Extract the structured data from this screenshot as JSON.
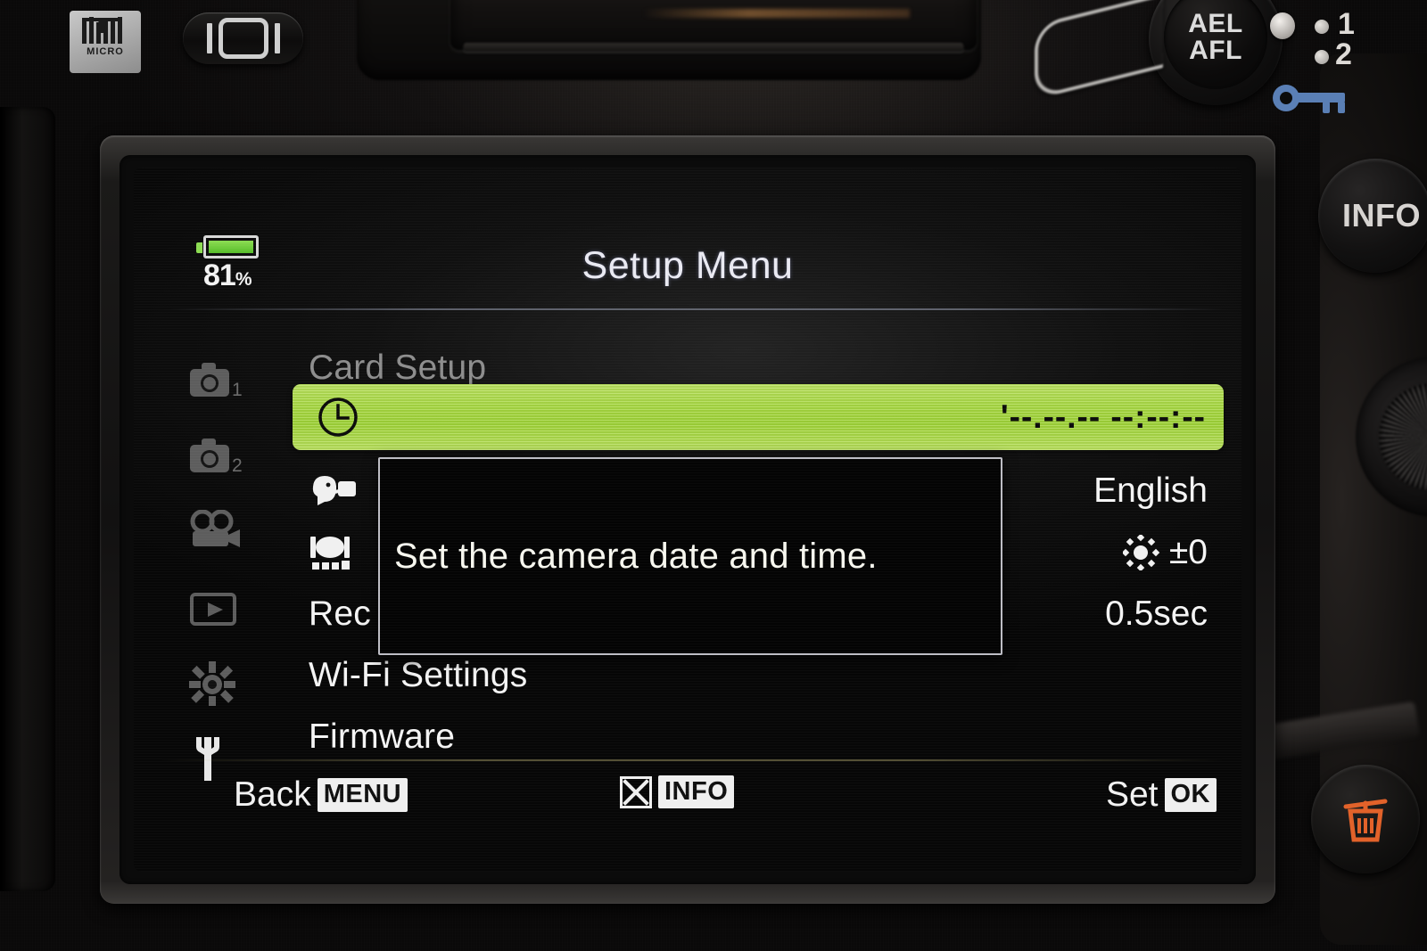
{
  "camera": {
    "logo_text": "MICRO",
    "lv_button": "live-view-button",
    "ael_afl_label_top": "AEL",
    "ael_afl_label_bottom": "AFL",
    "dial_position_1": "1",
    "dial_position_2": "2",
    "info_button": "INFO",
    "key_icon_color": "#5a7fb5",
    "trash_icon_color": "#e2622a"
  },
  "screen": {
    "battery": {
      "percent": "81",
      "unit": "%",
      "level_color": "#8cdc52"
    },
    "title": "Setup Menu",
    "highlight_color": "#a6d83f",
    "tabs": [
      {
        "name": "shooting-menu-1",
        "badge": "1"
      },
      {
        "name": "shooting-menu-2",
        "badge": "2"
      },
      {
        "name": "movie-menu",
        "badge": ""
      },
      {
        "name": "playback-menu",
        "badge": ""
      },
      {
        "name": "custom-menu",
        "badge": ""
      },
      {
        "name": "setup-menu",
        "badge": ""
      }
    ],
    "menu_items": [
      {
        "label": "Card Setup",
        "value": "",
        "icon": "",
        "state": "dim"
      },
      {
        "label": "",
        "value": "'--.--.-- --:--:--",
        "icon": "clock-icon",
        "state": "selected"
      },
      {
        "label": "",
        "value": "English",
        "icon": "language-icon",
        "state": "normal"
      },
      {
        "label": "",
        "value": "±0",
        "icon": "monitor-brightness-icon",
        "state": "normal"
      },
      {
        "label": "Rec View",
        "value": "0.5sec",
        "icon": "",
        "state": "normal"
      },
      {
        "label": "Wi-Fi Settings",
        "value": "",
        "icon": "",
        "state": "normal"
      },
      {
        "label": "Firmware",
        "value": "",
        "icon": "",
        "state": "normal"
      }
    ],
    "tooltip": {
      "text": "Set the camera date and time."
    },
    "bottom_bar": {
      "back_label": "Back",
      "back_badge": "MENU",
      "close_badge": "INFO",
      "set_label": "Set",
      "set_badge": "OK"
    }
  }
}
